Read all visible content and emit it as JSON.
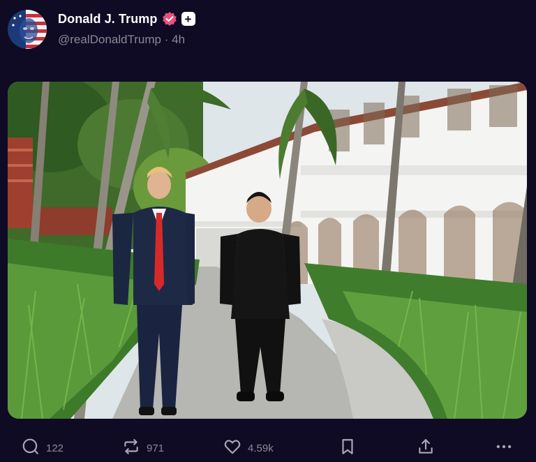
{
  "post": {
    "author_name": "Donald J. Trump",
    "plus_badge": "+",
    "handle": "@realDonaldTrump",
    "separator": "·",
    "time_ago": "4h"
  },
  "actions": {
    "replies": "122",
    "reposts": "971",
    "likes": "4.59k",
    "bookmark_icon": "bookmark-icon",
    "share_icon": "share-icon",
    "more_icon": "more-icon"
  },
  "colors": {
    "background": "#0f0b24",
    "verified": "#e8507a",
    "muted": "#8b8798"
  }
}
